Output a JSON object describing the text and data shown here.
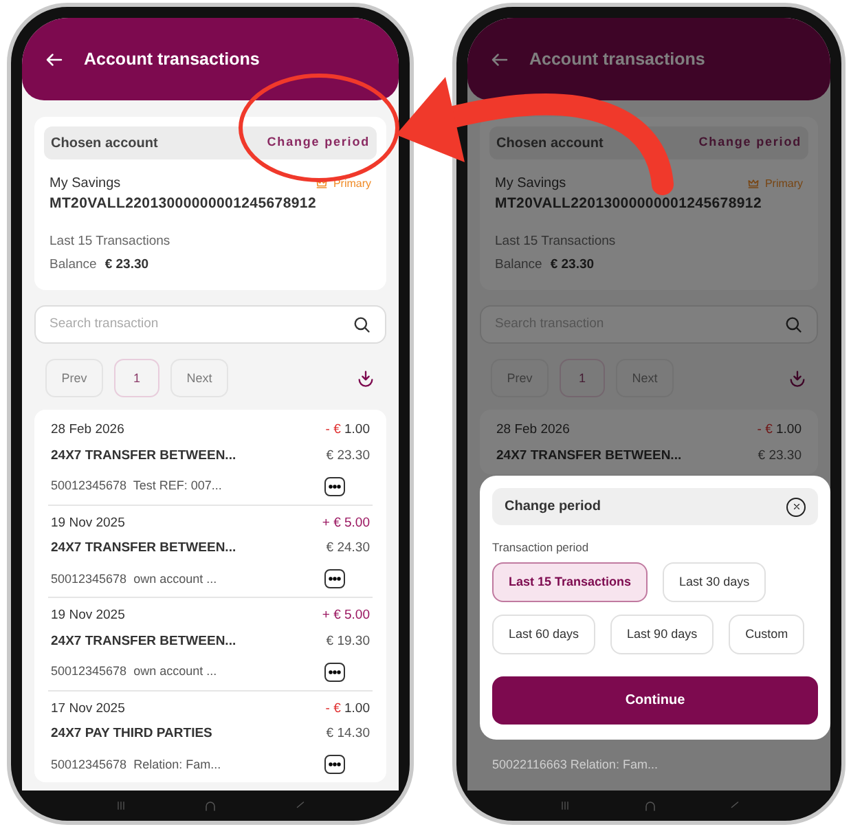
{
  "phones": [
    {
      "header": {
        "title": "Account transactions"
      },
      "account": {
        "section_label": "Chosen account",
        "change_link": "Change period",
        "name": "My Savings",
        "badge": "Primary",
        "iban": "MT20VALL22013000000001245678912",
        "period": "Last 15 Transactions",
        "balance_label": "Balance",
        "balance": "€ 23.30"
      },
      "search": {
        "placeholder": "Search transaction"
      },
      "pagination": {
        "prev": "Prev",
        "page": "1",
        "next": "Next",
        "disabled": true
      },
      "transactions": [
        {
          "kind": "debit",
          "date": "28 Feb 2026",
          "title": "24X7 TRANSFER BETWEEN...",
          "sign": "-",
          "currency": "€",
          "amount": "1.00",
          "balance": "€ 23.30",
          "account": "50012345678",
          "note": "Test REF: 007..."
        },
        {
          "kind": "credit",
          "date": "19 Nov 2025",
          "title": "24X7 TRANSFER BETWEEN...",
          "sign": "+",
          "currency": "€",
          "amount": "5.00",
          "balance": "€ 24.30",
          "account": "50012345678",
          "note": "own account ..."
        },
        {
          "kind": "credit",
          "date": "19 Nov 2025",
          "title": "24X7 TRANSFER BETWEEN...",
          "sign": "+",
          "currency": "€",
          "amount": "5.00",
          "balance": "€ 19.30",
          "account": "50012345678",
          "note": "own account ..."
        },
        {
          "kind": "debit",
          "date": "17 Nov 2025",
          "title": "24X7 PAY THIRD PARTIES",
          "sign": "-",
          "currency": "€",
          "amount": "1.00",
          "balance": "€ 14.30",
          "account": "50012345678",
          "note": "Relation: Fam..."
        }
      ]
    },
    {
      "header": {
        "title": "Account transactions"
      },
      "account": {
        "section_label": "Chosen account",
        "change_link": "Change period",
        "name": "My Savings",
        "badge": "Primary",
        "iban": "MT20VALL22013000000001245678912",
        "period": "Last 15 Transactions",
        "balance_label": "Balance",
        "balance": "€ 23.30"
      },
      "search": {
        "placeholder": "Search transaction"
      },
      "pagination": {
        "prev": "Prev",
        "page": "1",
        "next": "Next",
        "disabled": true
      },
      "transactions": [
        {
          "kind": "debit",
          "date": "28 Feb 2026",
          "title": "24X7 TRANSFER BETWEEN...",
          "sign": "-",
          "currency": "€",
          "amount": "1.00",
          "balance": "€ 23.30"
        }
      ],
      "hidden_row": {
        "account": "50022116663",
        "note": "Relation: Fam..."
      },
      "modal": {
        "title": "Change period",
        "label": "Transaction period",
        "options": [
          {
            "label": "Last 15 Transactions",
            "selected": true
          },
          {
            "label": "Last 30 days",
            "selected": false
          },
          {
            "label": "Last 60 days",
            "selected": false
          },
          {
            "label": "Last 90 days",
            "selected": false
          },
          {
            "label": "Custom",
            "selected": false
          }
        ],
        "button": "Continue"
      }
    }
  ]
}
